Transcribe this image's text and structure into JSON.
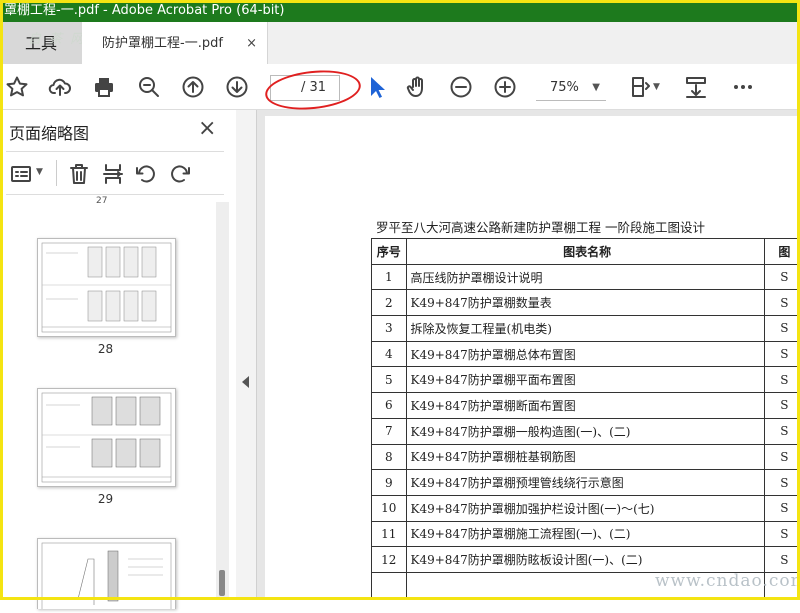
{
  "window": {
    "title": "罩棚工程-一.pdf - Adobe Acrobat Pro (64-bit)"
  },
  "tabs": {
    "tools_label": "工具",
    "document_tab": "防护罩棚工程-一.pdf",
    "close_glyph": "×"
  },
  "toolbar": {
    "current_page": "",
    "page_total": "/ 31",
    "zoom": "75%"
  },
  "sidebar": {
    "title": "页面缩略图",
    "close_glyph": "×",
    "partial_label": "27",
    "thumbnails": [
      {
        "label": "28"
      },
      {
        "label": "29"
      },
      {
        "label": ""
      }
    ]
  },
  "document": {
    "heading": "罗平至八大河高速公路新建防护罩棚工程 一阶段施工图设计",
    "table": {
      "headers": [
        "序号",
        "图表名称",
        "图"
      ],
      "rows": [
        [
          "1",
          "高压线防护罩棚设计说明",
          "S"
        ],
        [
          "2",
          "K49+847防护罩棚数量表",
          "S"
        ],
        [
          "3",
          "拆除及恢复工程量(机电类)",
          "S"
        ],
        [
          "4",
          "K49+847防护罩棚总体布置图",
          "S"
        ],
        [
          "5",
          "K49+847防护罩棚平面布置图",
          "S"
        ],
        [
          "6",
          "K49+847防护罩棚断面布置图",
          "S"
        ],
        [
          "7",
          "K49+847防护罩棚一般构造图(一)、(二)",
          "S"
        ],
        [
          "8",
          "K49+847防护罩棚桩基钢筋图",
          "S"
        ],
        [
          "9",
          "K49+847防护罩棚预埋管线绕行示意图",
          "S"
        ],
        [
          "10",
          "K49+847防护罩棚加强护栏设计图(一)～(七)",
          "S"
        ],
        [
          "11",
          "K49+847防护罩棚施工流程图(一)、(二)",
          "S"
        ],
        [
          "12",
          "K49+847防护罩棚防眩板设计图(一)、(二)",
          "S"
        ],
        [
          "",
          "",
          ""
        ]
      ]
    }
  },
  "watermark": {
    "site": "www.cndao.com",
    "logo": "自 茶 网"
  },
  "colors": {
    "titlebar": "#1d7a1d",
    "frame": "#f4e412",
    "annotation": "#e02020",
    "cursor": "#1e63d6"
  }
}
